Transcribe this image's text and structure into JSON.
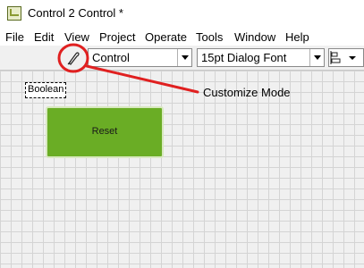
{
  "window": {
    "title": "Control 2 Control *",
    "app_icon": "labview-vi-icon"
  },
  "menu": {
    "items": [
      "File",
      "Edit",
      "View",
      "Project",
      "Operate",
      "Tools",
      "Window",
      "Help"
    ]
  },
  "toolbar": {
    "mode_icon": "customize-mode-wrench-icon",
    "type_select": "Control",
    "font_select": "15pt Dialog Font",
    "align_icon": "align-objects-icon"
  },
  "front_panel": {
    "boolean_label": "Boolean",
    "reset_button_label": "Reset",
    "reset_button_color": "#6aad25"
  },
  "annotation": {
    "text": "Customize Mode",
    "color": "#e02020"
  }
}
